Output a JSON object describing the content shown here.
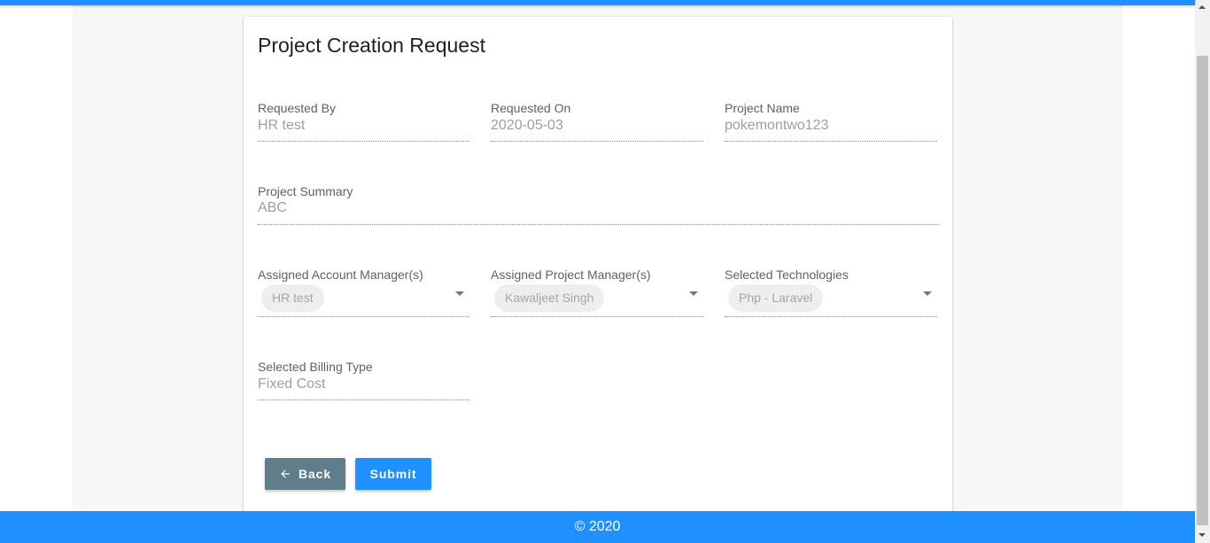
{
  "page": {
    "title": "Project Creation Request"
  },
  "fields": {
    "requested_by": {
      "label": "Requested By",
      "value": "HR test"
    },
    "requested_on": {
      "label": "Requested On",
      "value": "2020-05-03"
    },
    "project_name": {
      "label": "Project Name",
      "value": "pokemontwo123"
    },
    "project_summary": {
      "label": "Project Summary",
      "value": "ABC"
    },
    "account_managers": {
      "label": "Assigned Account Manager(s)",
      "chips": [
        "HR test"
      ]
    },
    "project_managers": {
      "label": "Assigned Project Manager(s)",
      "chips": [
        "Kawaljeet Singh"
      ]
    },
    "technologies": {
      "label": "Selected Technologies",
      "chips": [
        "Php - Laravel"
      ]
    },
    "billing_type": {
      "label": "Selected Billing Type",
      "value": "Fixed Cost"
    }
  },
  "actions": {
    "back_label": "Back",
    "submit_label": "Submit"
  },
  "footer": {
    "text": "© 2020"
  },
  "colors": {
    "primary": "#1e90ff",
    "back_button": "#607d8b",
    "chip_bg": "#eeeeee"
  },
  "icons": {
    "back": "arrow-left-icon",
    "dropdown": "caret-down-icon"
  }
}
